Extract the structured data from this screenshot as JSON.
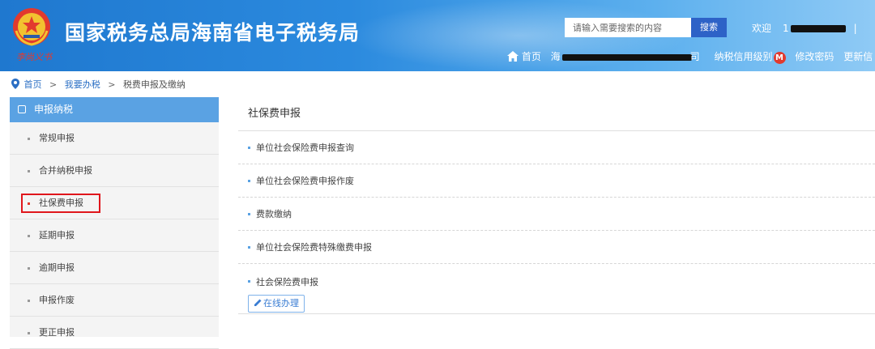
{
  "header": {
    "title": "国家税务总局海南省电子税务局",
    "motto": "李尚义书",
    "search_placeholder": "请输入需要搜索的内容",
    "search_button": "搜索",
    "welcome": "欢迎",
    "user_id_prefix": "1",
    "separator": "|",
    "nav": {
      "home": "首页",
      "company_prefix": "海",
      "company_suffix": "司",
      "credit_level": "纳税信用级别",
      "credit_badge": "M",
      "change_password": "修改密码",
      "update": "更新信"
    },
    "colors": {
      "brand_blue": "#2b8ade",
      "badge_red": "#e23a2e"
    }
  },
  "breadcrumb": {
    "items": [
      "首页",
      "我要办税",
      "税费申报及缴纳"
    ],
    "separator": ">"
  },
  "sidebar": {
    "header": "申报纳税",
    "items": [
      {
        "label": "常规申报"
      },
      {
        "label": "合并纳税申报"
      },
      {
        "label": "社保费申报",
        "active": true
      },
      {
        "label": "延期申报"
      },
      {
        "label": "逾期申报"
      },
      {
        "label": "申报作废"
      },
      {
        "label": "更正申报"
      }
    ]
  },
  "main": {
    "title": "社保费申报",
    "rows": [
      {
        "label": "单位社会保险费申报查询"
      },
      {
        "label": "单位社会保险费申报作废"
      },
      {
        "label": "费款缴纳"
      },
      {
        "label": "单位社会保险费特殊缴费申报"
      },
      {
        "label": "社会保险费申报",
        "action": "在线办理"
      }
    ]
  }
}
